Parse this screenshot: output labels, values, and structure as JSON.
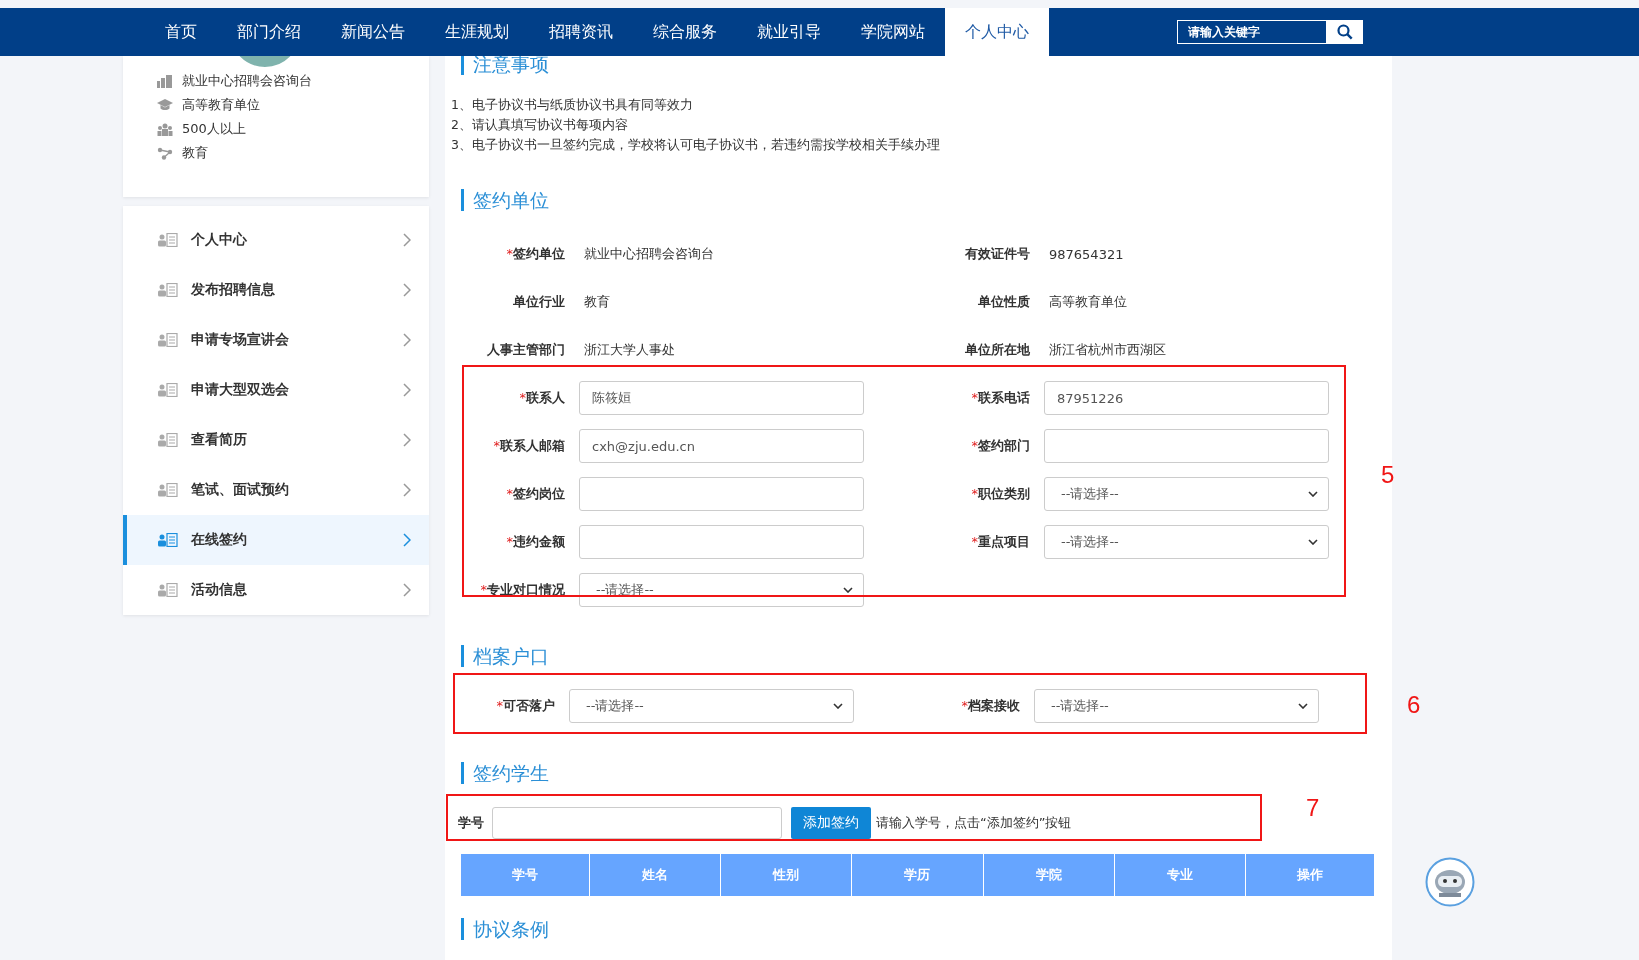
{
  "nav": {
    "items": [
      {
        "label": "首页",
        "selected": false
      },
      {
        "label": "部门介绍",
        "selected": false
      },
      {
        "label": "新闻公告",
        "selected": false
      },
      {
        "label": "生涯规划",
        "selected": false
      },
      {
        "label": "招聘资讯",
        "selected": false
      },
      {
        "label": "综合服务",
        "selected": false
      },
      {
        "label": "就业引导",
        "selected": false
      },
      {
        "label": "学院网站",
        "selected": false
      },
      {
        "label": "个人中心",
        "selected": true
      }
    ],
    "search": {
      "placeholder": "请输入关键字"
    }
  },
  "company_card": {
    "info": [
      {
        "kind": "building",
        "text": "就业中心招聘会咨询台"
      },
      {
        "kind": "cap",
        "text": "高等教育单位"
      },
      {
        "kind": "people",
        "text": "500人以上"
      },
      {
        "kind": "network",
        "text": "教育"
      }
    ]
  },
  "sidebar": {
    "items": [
      {
        "label": "个人中心",
        "selected": false
      },
      {
        "label": "发布招聘信息",
        "selected": false
      },
      {
        "label": "申请专场宣讲会",
        "selected": false
      },
      {
        "label": "申请大型双选会",
        "selected": false
      },
      {
        "label": "查看简历",
        "selected": false
      },
      {
        "label": "笔试、面试预约",
        "selected": false
      },
      {
        "label": "在线签约",
        "selected": true
      },
      {
        "label": "活动信息",
        "selected": false
      }
    ]
  },
  "notice": {
    "title": "注意事项",
    "lines": [
      "1、电子协议书与纸质协议书具有同等效力",
      "2、请认真填写协议书每项内容",
      "3、电子协议书一旦签约完成，学校将认可电子协议书，若违约需按学校相关手续办理"
    ]
  },
  "unit": {
    "title": "签约单位",
    "info_fields": [
      {
        "label": "签约单位",
        "required_mark": "*",
        "value": "就业中心招聘会咨询台"
      },
      {
        "label": "有效证件号",
        "value": "987654321"
      },
      {
        "label": "单位行业",
        "value": "教育"
      },
      {
        "label": "单位性质",
        "value": "高等教育单位"
      },
      {
        "label": "人事主管部门",
        "value": "浙江大学人事处"
      },
      {
        "label": "单位所在地",
        "value": "浙江省杭州市西湖区"
      }
    ],
    "form_fields": [
      {
        "label": "联系人",
        "required_mark": "*",
        "kind": "input",
        "value": "陈筱姮"
      },
      {
        "label": "联系电话",
        "required_mark": "*",
        "kind": "input",
        "value": "87951226"
      },
      {
        "label": "联系人邮箱",
        "required_mark": "*",
        "kind": "input",
        "value": "cxh@zju.edu.cn"
      },
      {
        "label": "签约部门",
        "required_mark": "*",
        "kind": "input"
      },
      {
        "label": "签约岗位",
        "required_mark": "*",
        "kind": "input"
      },
      {
        "label": "职位类别",
        "required_mark": "*",
        "kind": "select",
        "value": "--请选择--"
      },
      {
        "label": "违约金额",
        "required_mark": "*",
        "kind": "input"
      },
      {
        "label": "重点项目",
        "required_mark": "*",
        "kind": "select",
        "value": "--请选择--"
      },
      {
        "label": "专业对口情况",
        "required_mark": "*",
        "kind": "select",
        "value": "--请选择--"
      }
    ],
    "annotation": "5"
  },
  "archive": {
    "title": "档案户口",
    "form_fields": [
      {
        "label": "可否落户",
        "required_mark": "*",
        "kind": "select",
        "value": "--请选择--"
      },
      {
        "label": "档案接收",
        "required_mark": "*",
        "kind": "select",
        "value": "--请选择--"
      }
    ],
    "annotation": "6"
  },
  "students": {
    "title": "签约学生",
    "id_label": "学号",
    "add_button": "添加签约",
    "hint": "请输入学号，点击“添加签约”按钮",
    "annotation": "7",
    "table": {
      "columns": [
        "学号",
        "姓名",
        "性别",
        "学历",
        "学院",
        "专业",
        "操作"
      ]
    }
  },
  "terms": {
    "title": "协议条例"
  }
}
